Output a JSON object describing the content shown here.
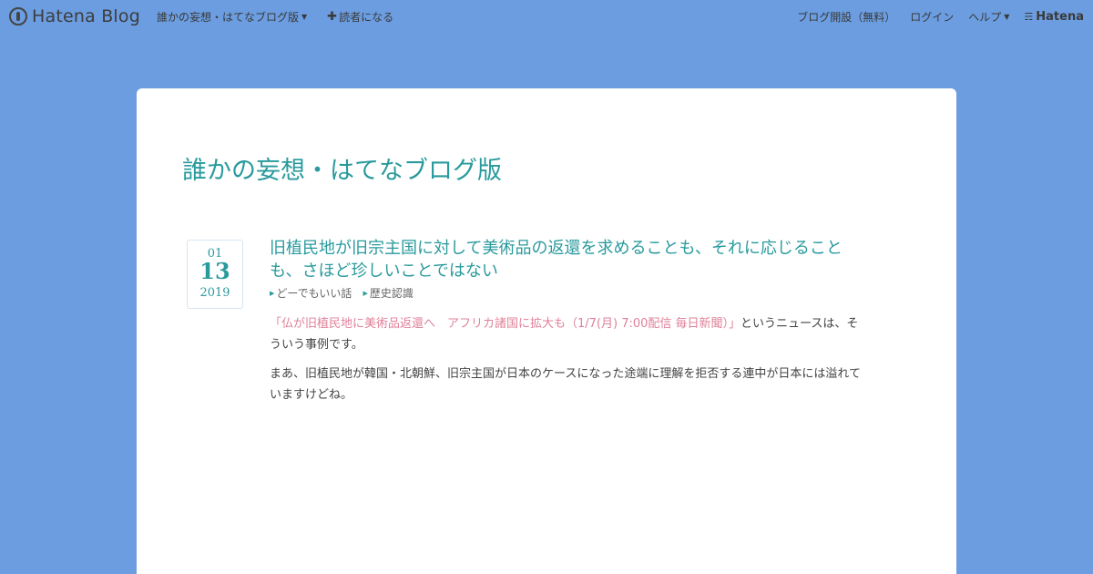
{
  "topbar": {
    "logo_text": "Hatena Blog",
    "blog_menu_label": "誰かの妄想・はてなブログ版",
    "subscribe_label": "読者になる",
    "create_blog_label": "ブログ開設（無料）",
    "login_label": "ログイン",
    "help_label": "ヘルプ",
    "brand_label": "Hatena"
  },
  "blog": {
    "title": "誰かの妄想・はてなブログ版"
  },
  "entry": {
    "date": {
      "month": "01",
      "day": "13",
      "year": "2019"
    },
    "title": "旧植民地が旧宗主国に対して美術品の返還を求めることも、それに応じることも、さほど珍しいことではない",
    "categories": [
      "どーでもいい話",
      "歴史認識"
    ],
    "paragraph1_link": "「仏が旧植民地に美術品返還へ　アフリカ諸国に拡大も（1/7(月) 7:00配信 毎日新聞）」",
    "paragraph1_rest": "というニュースは、そういう事例です。",
    "paragraph2": "まあ、旧植民地が韓国・北朝鮮、旧宗主国が日本のケースになった途端に理解を拒否する連中が日本には溢れていますけどね。"
  },
  "colors": {
    "background": "#6b9de0",
    "accent": "#2a9a9d",
    "link": "#e0809a"
  },
  "icons": [
    "hatena-logo-icon",
    "caret-down-icon",
    "plus-icon",
    "hatena-brand-icon",
    "category-arrow-icon"
  ]
}
